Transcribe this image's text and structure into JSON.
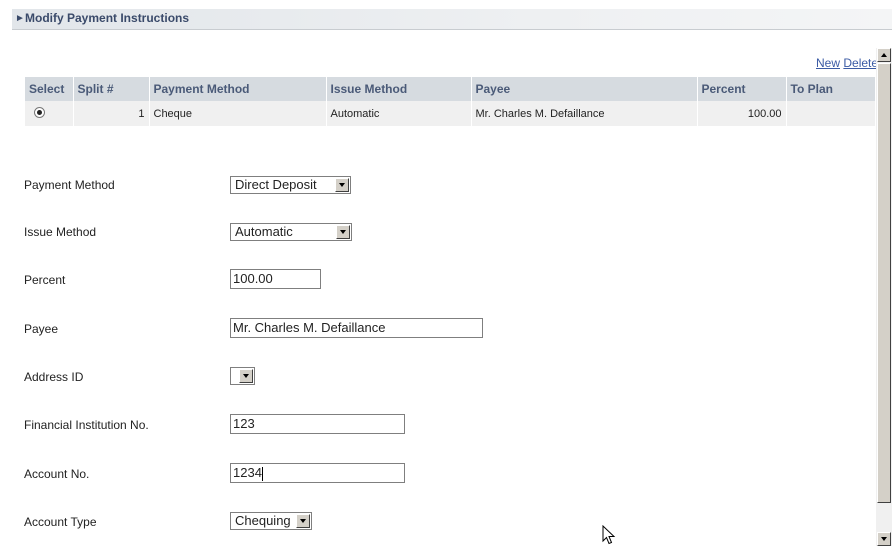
{
  "section": {
    "title": "Modify Payment Instructions"
  },
  "grid_actions": {
    "new_label": "New",
    "delete_label": "Delete"
  },
  "grid": {
    "columns": [
      "Select",
      "Split #",
      "Payment Method",
      "Issue Method",
      "Payee",
      "Percent",
      "To Plan"
    ],
    "rows": [
      {
        "selected": true,
        "split": "1",
        "payment_method": "Cheque",
        "issue_method": "Automatic",
        "payee": "Mr. Charles M. Defaillance",
        "percent": "100.00",
        "to_plan": ""
      }
    ]
  },
  "form": {
    "payment_method": {
      "label": "Payment Method",
      "value": "Direct Deposit"
    },
    "issue_method": {
      "label": "Issue Method",
      "value": "Automatic"
    },
    "percent": {
      "label": "Percent",
      "value": "100.00"
    },
    "payee": {
      "label": "Payee",
      "value": "Mr. Charles M. Defaillance"
    },
    "address_id": {
      "label": "Address ID",
      "value": ""
    },
    "financial_institution": {
      "label": "Financial Institution No.",
      "value": "123"
    },
    "account_no": {
      "label": "Account No.",
      "value": "1234"
    },
    "account_type": {
      "label": "Account Type",
      "value": "Chequing"
    }
  }
}
